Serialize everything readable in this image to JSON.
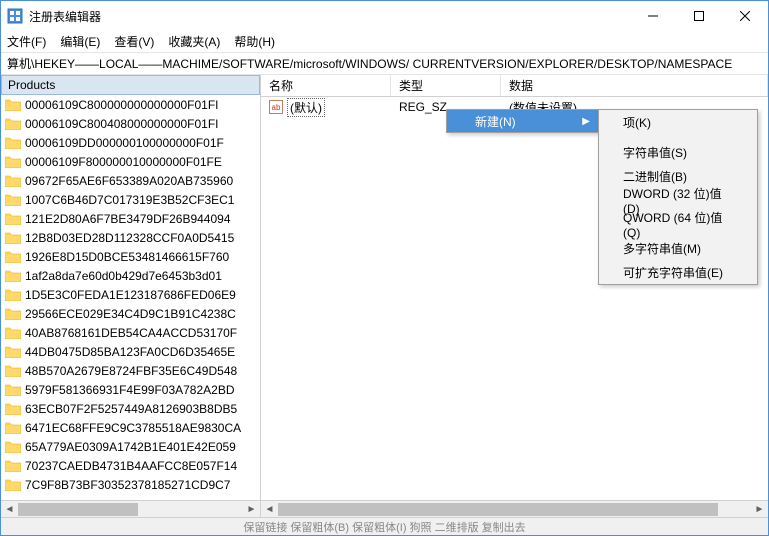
{
  "window": {
    "title": "注册表编辑器"
  },
  "menu": {
    "file": "文件(F)",
    "edit": "编辑(E)",
    "view": "查看(V)",
    "favorites": "收藏夹(A)",
    "help": "帮助(H)"
  },
  "address": "算机\\HEKEY——LOCAL——MACHIME/SOFTWARE/microsoft/WINDOWS/ CURRENTVERSION/EXPLORER/DESKTOP/NAMESPACE",
  "left_header": "Products",
  "tree": [
    "00006109C800000000000000F01FI",
    "00006109C800408000000000F01FI",
    "00006109DD000000100000000F01F",
    "00006109F800000010000000F01FE",
    "09672F65AE6F653389A020AB735960",
    "1007C6B46D7C017319E3B52CF3EC1",
    "121E2D80A6F7BE3479DF26B944094",
    "12B8D03ED28D112328CCF0A0D5415",
    "1926E8D15D0BCE53481466615F760",
    "1af2a8da7e60d0b429d7e6453b3d01",
    "1D5E3C0FEDA1E123187686FED06E9",
    "29566ECE029E34C4D9C1B91C4238C",
    "40AB8768161DEB54CA4ACCD53170F",
    "44DB0475D85BA123FA0CD6D35465E",
    "48B570A2679E8724FBF35E6C49D548",
    "5979F581366931F4E99F03A782A2BD",
    "63ECB07F2F5257449A8126903B8DB5",
    "6471EC68FFE9C9C3785518AE9830CA",
    "65A779AE0309A1742B1E401E42E059",
    "70237CAEDB4731B4AAFCC8E057F14",
    "7C9F8B73BF30352378185271CD9C7"
  ],
  "columns": {
    "name": "名称",
    "type": "类型",
    "data": "数据"
  },
  "row": {
    "ab": "ab",
    "name": "(默认)",
    "type": "REG_SZ",
    "data": "(数值未设置)"
  },
  "ctx1": {
    "new": "新建(N)"
  },
  "ctx2": {
    "key": "项(K)",
    "string": "字符串值(S)",
    "binary": "二进制值(B)",
    "dword": "DWORD (32 位)值(D)",
    "qword": "QWORD (64 位)值(Q)",
    "multi": "多字符串值(M)",
    "expand": "可扩充字符串值(E)"
  },
  "status": "保留链接        保留粗体(B)        保留粗体(I)        狗照    二维排版    复制出去"
}
